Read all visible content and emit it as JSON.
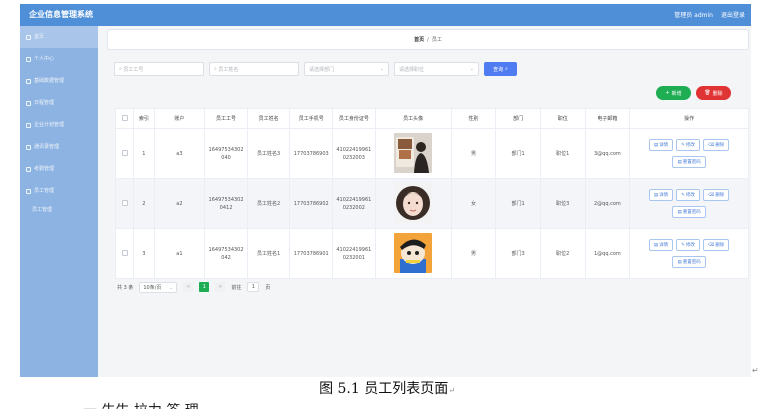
{
  "app": {
    "brand": "企业信息管理系统",
    "user": "管理员 admin",
    "logout": "退出登录"
  },
  "sidebar": {
    "items": [
      {
        "label": "首页"
      },
      {
        "label": "个人中心"
      },
      {
        "label": "基础数据管理"
      },
      {
        "label": "日程管理"
      },
      {
        "label": "企业计划管理"
      },
      {
        "label": "通讯录管理"
      },
      {
        "label": "考勤管理"
      },
      {
        "label": "员工管理"
      },
      {
        "label": "员工管理"
      }
    ]
  },
  "breadcrumb": {
    "home": "首页",
    "sep": "/",
    "current": "员工"
  },
  "search": {
    "emp_no_placeholder": "员工工号",
    "emp_name_placeholder": "员工姓名",
    "dept_placeholder": "请选择部门",
    "post_placeholder": "请选择职位",
    "query_label": "查询"
  },
  "toolbar": {
    "add_label": "新增",
    "delete_label": "删除"
  },
  "table": {
    "headers": [
      "",
      "索引",
      "账户",
      "员工工号",
      "员工姓名",
      "员工手机号",
      "员工身份证号",
      "员工头像",
      "性别",
      "部门",
      "职位",
      "电子邮箱",
      "操作"
    ],
    "rows": [
      {
        "index": "1",
        "account": "a3",
        "emp_no": "16497534302040",
        "name": "员工姓名3",
        "phone": "17703786903",
        "id_card": "410224199610232003",
        "gender": "男",
        "dept": "部门1",
        "post": "职位1",
        "email": "3@qq.com"
      },
      {
        "index": "2",
        "account": "a2",
        "emp_no": "164975343020412",
        "name": "员工姓名2",
        "phone": "17703786902",
        "id_card": "410224199610232002",
        "gender": "女",
        "dept": "部门1",
        "post": "职位3",
        "email": "2@qq.com"
      },
      {
        "index": "3",
        "account": "a1",
        "emp_no": "16497534302042",
        "name": "员工姓名1",
        "phone": "17703786901",
        "id_card": "410224199610232001",
        "gender": "男",
        "dept": "部门3",
        "post": "职位2",
        "email": "1@qq.com"
      }
    ],
    "ops": {
      "detail": "详情",
      "edit": "修改",
      "delete": "删除",
      "reset_pwd": "重置密码"
    }
  },
  "pager": {
    "total": "共 3 条",
    "page_size": "10条/页",
    "prev": "<",
    "current": "1",
    "next": ">",
    "goto": "前往",
    "goto_value": "1",
    "page_unit": "页"
  },
  "caption": {
    "text": "图 5.1 员工列表页面"
  },
  "below_text": "一 牛牛 拉力 答 理",
  "colors": {
    "topbar": "#4f8fd8",
    "sidebar": "#8db3e2",
    "primary": "#4f7cf0",
    "success": "#1fad54",
    "danger": "#e03333"
  }
}
